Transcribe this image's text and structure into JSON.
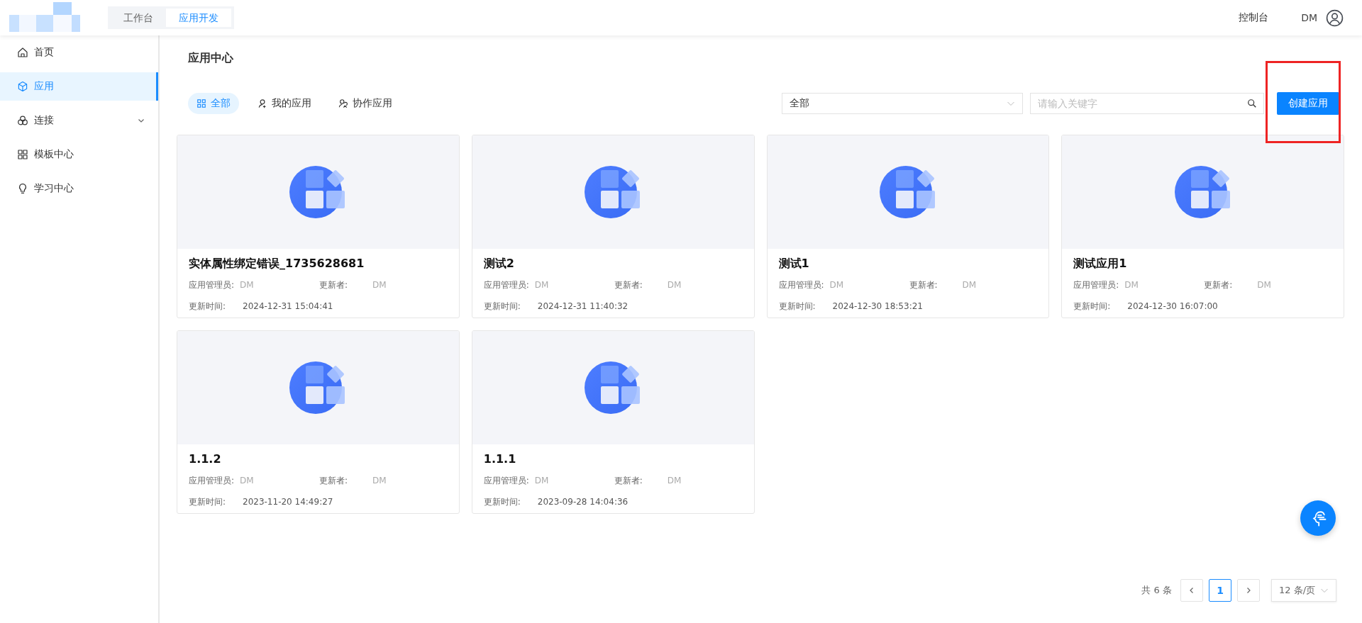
{
  "header": {
    "nav_tabs": [
      {
        "label": "工作台",
        "selected": false
      },
      {
        "label": "应用开发",
        "selected": true
      }
    ],
    "console_link": "控制台",
    "user_name": "DM"
  },
  "sidebar": {
    "items": [
      {
        "label": "首页",
        "kind": "link",
        "selected": false
      },
      {
        "label": "应用",
        "kind": "link",
        "selected": true
      },
      {
        "label": "连接",
        "kind": "group",
        "selected": false
      },
      {
        "label": "模板中心",
        "kind": "link",
        "selected": false
      },
      {
        "label": "学习中心",
        "kind": "link",
        "selected": false
      }
    ]
  },
  "page_title": "应用中心",
  "filter_tabs": [
    {
      "label": "全部",
      "selected": true
    },
    {
      "label": "我的应用",
      "selected": false
    },
    {
      "label": "协作应用",
      "selected": false
    }
  ],
  "type_select": {
    "value": "全部"
  },
  "search": {
    "placeholder": "请输入关键字"
  },
  "create_button": {
    "label": "创建应用",
    "highlighted": true
  },
  "apps": [
    {
      "name": "实体属性绑定错误_1735628681",
      "admin_label": "应用管理员:",
      "admin": "DM",
      "updater_label": "更新者:",
      "updater": "DM",
      "time_label": "更新时间:",
      "time": "2024-12-31 15:04:41"
    },
    {
      "name": "测试2",
      "admin_label": "应用管理员:",
      "admin": "DM",
      "updater_label": "更新者:",
      "updater": "DM",
      "time_label": "更新时间:",
      "time": "2024-12-31 11:40:32"
    },
    {
      "name": "测试1",
      "admin_label": "应用管理员:",
      "admin": "DM",
      "updater_label": "更新者:",
      "updater": "DM",
      "time_label": "更新时间:",
      "time": "2024-12-30 18:53:21"
    },
    {
      "name": "测试应用1",
      "admin_label": "应用管理员:",
      "admin": "DM",
      "updater_label": "更新者:",
      "updater": "DM",
      "time_label": "更新时间:",
      "time": "2024-12-30 16:07:00"
    },
    {
      "name": "1.1.2",
      "admin_label": "应用管理员:",
      "admin": "DM",
      "updater_label": "更新者:",
      "updater": "DM",
      "time_label": "更新时间:",
      "time": "2023-11-20 14:49:27"
    },
    {
      "name": "1.1.1",
      "admin_label": "应用管理员:",
      "admin": "DM",
      "updater_label": "更新者:",
      "updater": "DM",
      "time_label": "更新时间:",
      "time": "2023-09-28 14:04:36"
    }
  ],
  "pagination": {
    "total": "共 6 条",
    "pages": [
      {
        "label": "1",
        "selected": true
      }
    ],
    "page_size": "12 条/页"
  }
}
